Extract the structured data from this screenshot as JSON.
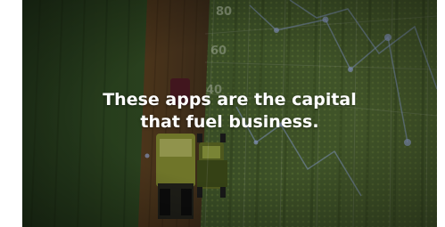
{
  "video_frame": {
    "caption_line1": "These apps are the capital",
    "caption_line2": "that fuel business.",
    "overlay_ticks": [
      "80",
      "60",
      "40"
    ],
    "accent_color": "#8fb4ff"
  }
}
